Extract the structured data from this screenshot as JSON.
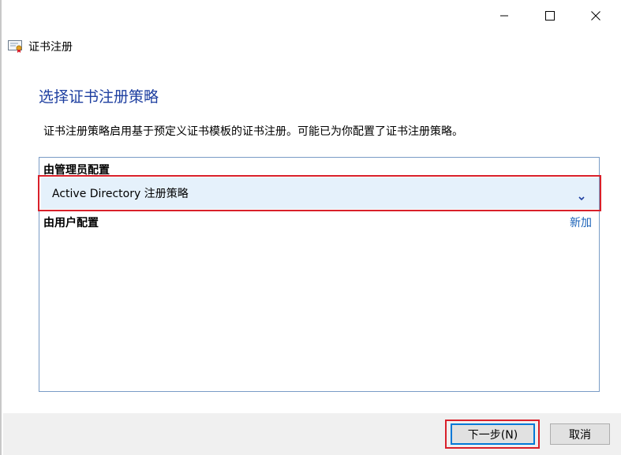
{
  "window": {
    "title": "证书注册",
    "controls": [
      "minimize",
      "maximize",
      "close"
    ]
  },
  "page": {
    "heading": "选择证书注册策略",
    "description": "证书注册策略启用基于预定义证书模板的证书注册。可能已为你配置了证书注册策略。"
  },
  "admin_section": {
    "label": "由管理员配置",
    "selected_policy": "Active Directory 注册策略"
  },
  "user_section": {
    "label": "由用户配置",
    "add_link": "新加"
  },
  "footer": {
    "next_label": "下一步(N)",
    "cancel_label": "取消"
  },
  "colors": {
    "heading": "#1e3fa0",
    "link": "#1a62b8",
    "highlight": "#d9202a",
    "selection_bg": "#e5f1fb",
    "footer_bg": "#f0f0f0"
  }
}
